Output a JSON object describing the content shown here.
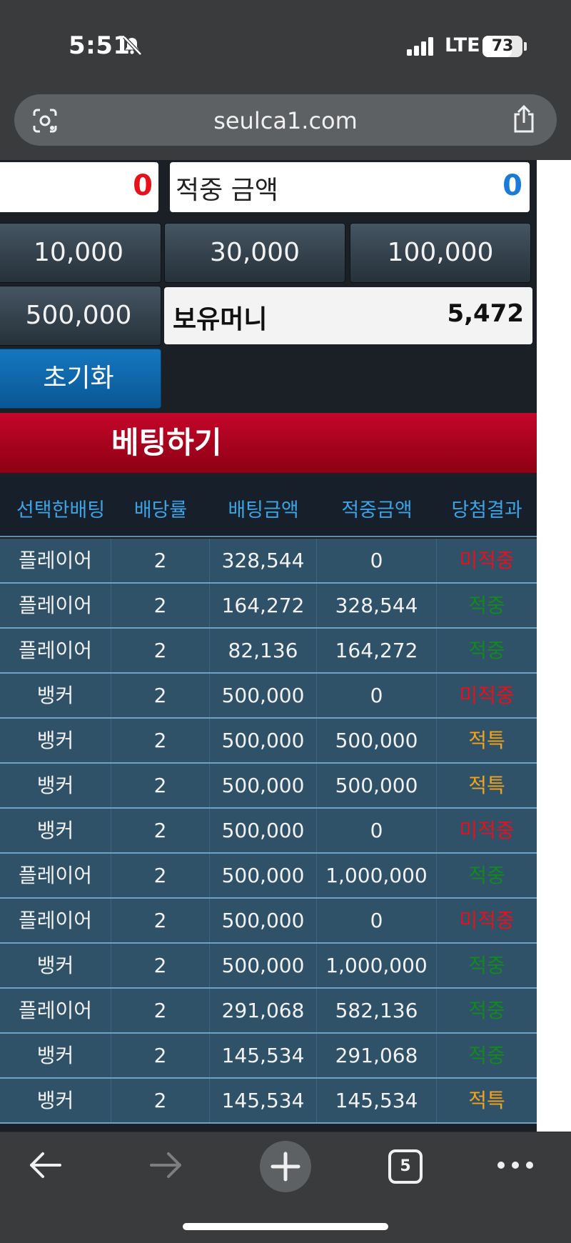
{
  "status_bar": {
    "time": "5:51",
    "network": "LTE",
    "battery_level": "73"
  },
  "browser": {
    "url": "seulca1.com",
    "tab_count": "5"
  },
  "bet_panel": {
    "left_value": "0",
    "hit_amount_label": "적중 금액",
    "hit_amount_value": "0",
    "chips": [
      "10,000",
      "30,000",
      "100,000",
      "500,000"
    ],
    "money_label": "보유머니",
    "money_value": "5,472",
    "reset_label": "초기화",
    "bet_label": "베팅하기"
  },
  "history": {
    "columns": [
      "선택한배팅",
      "배당률",
      "배팅금액",
      "적중금액",
      "당첨결과"
    ],
    "rows": [
      {
        "pick": "플레이어",
        "odds": "2",
        "bet": "328,544",
        "hit": "0",
        "result": "미적중",
        "type": "lose"
      },
      {
        "pick": "플레이어",
        "odds": "2",
        "bet": "164,272",
        "hit": "328,544",
        "result": "적중",
        "type": "win"
      },
      {
        "pick": "플레이어",
        "odds": "2",
        "bet": "82,136",
        "hit": "164,272",
        "result": "적중",
        "type": "win"
      },
      {
        "pick": "뱅커",
        "odds": "2",
        "bet": "500,000",
        "hit": "0",
        "result": "미적중",
        "type": "lose"
      },
      {
        "pick": "뱅커",
        "odds": "2",
        "bet": "500,000",
        "hit": "500,000",
        "result": "적특",
        "type": "tie"
      },
      {
        "pick": "뱅커",
        "odds": "2",
        "bet": "500,000",
        "hit": "500,000",
        "result": "적특",
        "type": "tie"
      },
      {
        "pick": "뱅커",
        "odds": "2",
        "bet": "500,000",
        "hit": "0",
        "result": "미적중",
        "type": "lose"
      },
      {
        "pick": "플레이어",
        "odds": "2",
        "bet": "500,000",
        "hit": "1,000,000",
        "result": "적중",
        "type": "win"
      },
      {
        "pick": "플레이어",
        "odds": "2",
        "bet": "500,000",
        "hit": "0",
        "result": "미적중",
        "type": "lose"
      },
      {
        "pick": "뱅커",
        "odds": "2",
        "bet": "500,000",
        "hit": "1,000,000",
        "result": "적중",
        "type": "win"
      },
      {
        "pick": "플레이어",
        "odds": "2",
        "bet": "291,068",
        "hit": "582,136",
        "result": "적중",
        "type": "win"
      },
      {
        "pick": "뱅커",
        "odds": "2",
        "bet": "145,534",
        "hit": "291,068",
        "result": "적중",
        "type": "win"
      },
      {
        "pick": "뱅커",
        "odds": "2",
        "bet": "145,534",
        "hit": "145,534",
        "result": "적특",
        "type": "tie"
      }
    ]
  },
  "colors": {
    "lose": "#e8101a",
    "win": "#12891c",
    "tie": "#f2a31a",
    "header_text": "#3aa4e6",
    "bet_button": "#c5062a"
  }
}
